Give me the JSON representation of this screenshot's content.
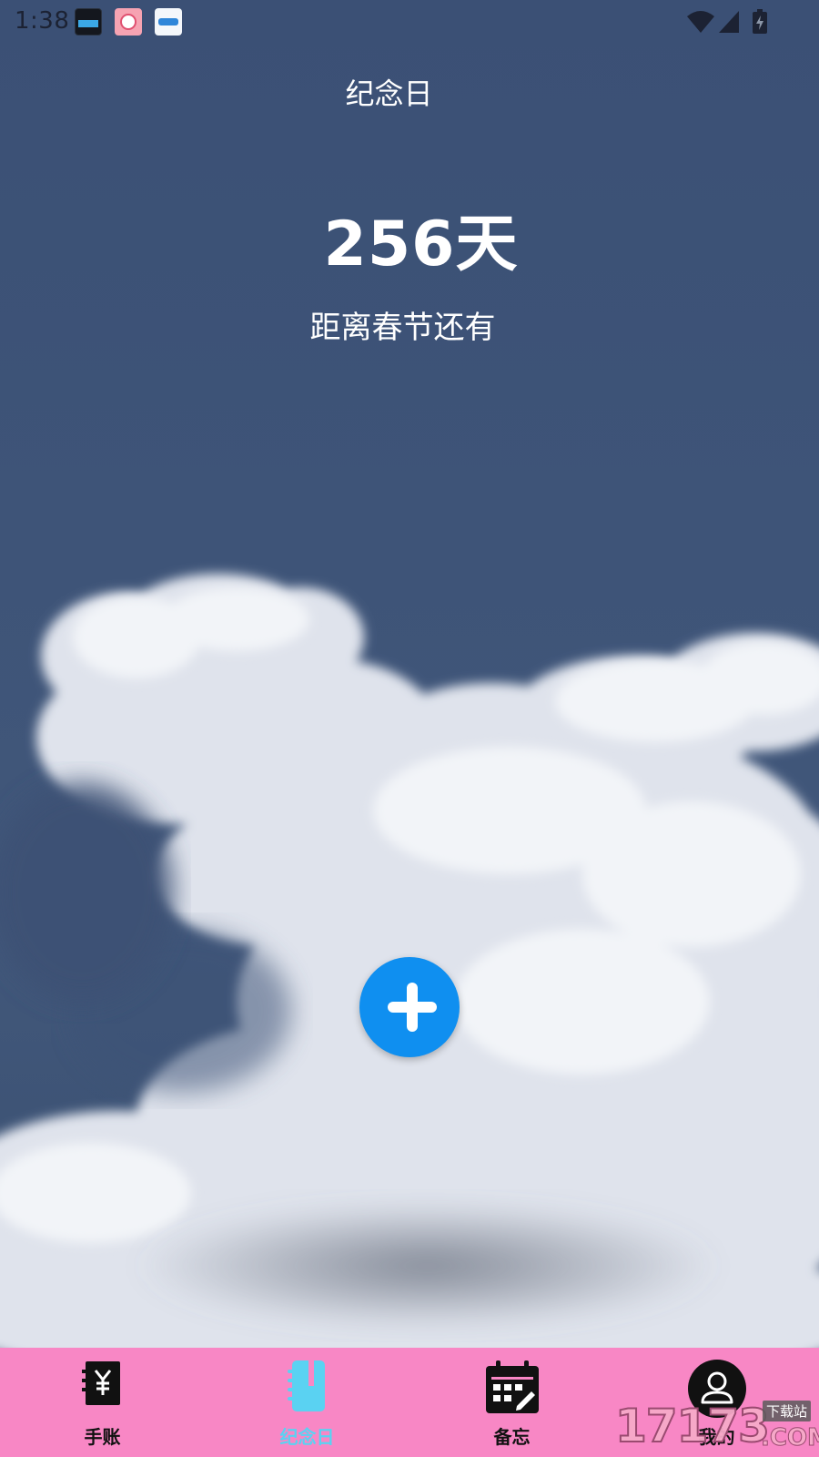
{
  "status_bar": {
    "time": "1:38",
    "icons": [
      "app-notification-icon",
      "app-notification-icon",
      "app-notification-icon",
      "wifi-icon",
      "cellular-signal-icon",
      "battery-charging-icon"
    ]
  },
  "header": {
    "title": "纪念日"
  },
  "countdown": {
    "days": "256天",
    "label": "距离春节还有"
  },
  "fab": {
    "icon": "plus-icon",
    "color": "#0f8ff0"
  },
  "bottom_nav": {
    "background": "#f887c5",
    "active_color": "#5ad2f2",
    "items": [
      {
        "label": "手账",
        "icon": "yuan-notebook-icon",
        "active": false
      },
      {
        "label": "纪念日",
        "icon": "notebook-icon",
        "active": true
      },
      {
        "label": "备忘",
        "icon": "calendar-icon",
        "active": false
      },
      {
        "label": "我的",
        "icon": "user-icon",
        "active": false
      }
    ]
  },
  "watermark": {
    "number": "17173",
    "tag": "下载站",
    "suffix": ".COM"
  }
}
